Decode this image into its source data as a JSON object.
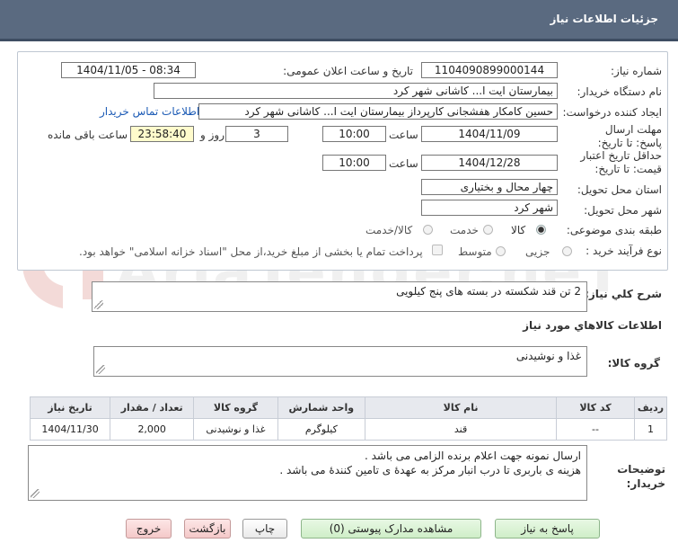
{
  "header": {
    "title": "جزئیات اطلاعات نیاز"
  },
  "form": {
    "need_number_label": "شماره نیاز:",
    "need_number": "1104090899000144",
    "announce_label": "تاریخ و ساعت اعلان عمومی:",
    "announce_value": "1404/11/05 - 08:34",
    "buyer_org_label": "نام دستگاه خریدار:",
    "buyer_org": "بیمارستان ایت ا... کاشانی شهر کرد",
    "creator_label": "ایجاد کننده درخواست:",
    "creator": "حسین کامکار هفشجانی کارپرداز بیمارستان ایت ا... کاشانی شهر کرد",
    "contact_link": "اطلاعات تماس خریدار",
    "deadline_label": "مهلت ارسال پاسخ: تا تاریخ:",
    "deadline_date": "1404/11/09",
    "time_label": "ساعت",
    "deadline_time": "10:00",
    "days_value": "3",
    "days_label": "روز و",
    "remaining_time": "23:58:40",
    "remaining_label": "ساعت باقی مانده",
    "validity_label": "حداقل تاریخ اعتبار قیمت: تا تاریخ:",
    "validity_date": "1404/12/28",
    "validity_time": "10:00",
    "province_label": "استان محل تحویل:",
    "province": "چهار محال و بختیاری",
    "city_label": "شهر محل تحویل:",
    "city": "شهر کرد",
    "category_label": "طبقه بندی موضوعی:",
    "category_options": [
      "کالا",
      "خدمت",
      "کالا/خدمت"
    ],
    "process_label": "نوع فرآیند خرید :",
    "process_options": [
      "جزیی",
      "متوسط"
    ],
    "payment_note": "پرداخت تمام یا بخشی از مبلغ خرید،از محل \"اسناد خزانه اسلامی\" خواهد بود."
  },
  "summary": {
    "label": "شرح کلي نیاز:",
    "text": "2 تن قند شکسته در بسته های پنج کیلویی"
  },
  "goods_info_title": "اطلاعات كالاهاي مورد نیاز",
  "goods_group": {
    "label": "گروه کالا:",
    "value": "غذا و نوشیدنی"
  },
  "table": {
    "headers": [
      "ردیف",
      "کد کالا",
      "نام کالا",
      "واحد شمارش",
      "گروه کالا",
      "تعداد / مقدار",
      "تاریخ نیاز"
    ],
    "rows": [
      [
        "1",
        "--",
        "قند",
        "کیلوگرم",
        "غذا و نوشیدنی",
        "2,000",
        "1404/11/30"
      ]
    ]
  },
  "buyer_notes": {
    "label": "توضیحات خریدار:",
    "line1": "ارسال نمونه جهت اعلام برنده الزامی می باشد .",
    "line2": "هزینه ی باربری تا درب انبار مرکز به عهدهٔ ی تامین کنندهٔ می باشد ."
  },
  "buttons": {
    "reply": "پاسخ به نیاز",
    "attachments": "مشاهده مدارک پیوستی (0)",
    "print": "چاپ",
    "back": "بازگشت",
    "exit": "خروج"
  },
  "watermark": {
    "text": "AriaTender.neT"
  },
  "colors": {
    "header_bg": "#5a6a80",
    "timer_bg": "#fffbcc",
    "link": "#1b5ab5"
  }
}
